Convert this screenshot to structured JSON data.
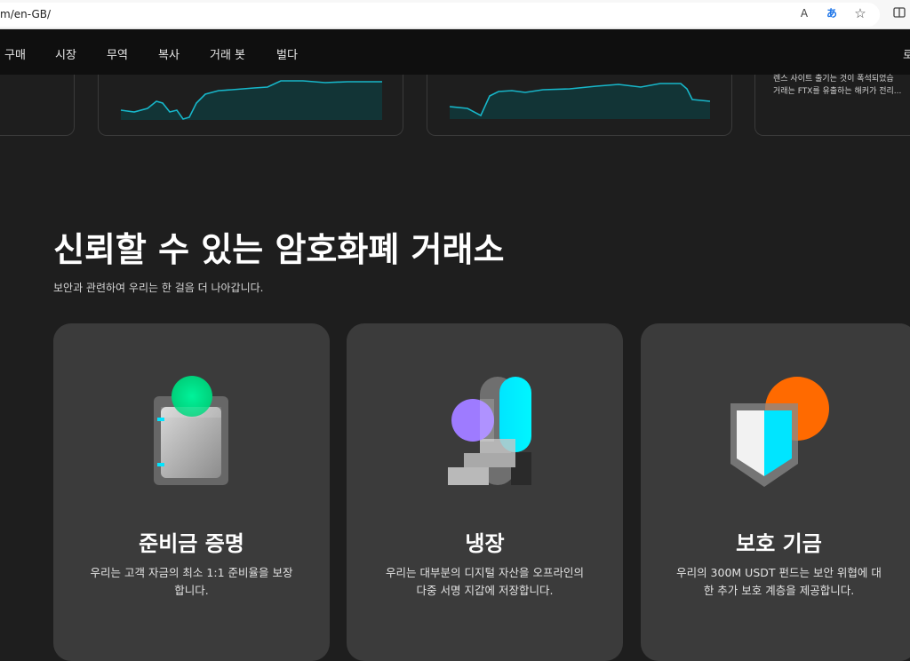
{
  "browser": {
    "url": "m/en-GB/",
    "read_aloud_icon": "A",
    "translate_icon": "あ",
    "favorite_icon": "☆",
    "reading_view_icon": "▯▯"
  },
  "nav": {
    "items": [
      "구매",
      "시장",
      "무역",
      "복사",
      "거래 봇",
      "벌다"
    ],
    "right_partial": "로"
  },
  "news_card": {
    "line1": "렌스 사이트 출기는 것이 폭석되었습",
    "line2": "거래는 FTX를 유출하는 해커가 전리..."
  },
  "hero": {
    "title": "신뢰할 수 있는 암호화폐 거래소",
    "subtitle": "보안과 관련하여 우리는 한 걸음 더 나아갑니다."
  },
  "features": [
    {
      "title": "준비금 증명",
      "desc_line1": "우리는 고객 자금의 최소 1:1 준비율을 보장",
      "desc_line2": "합니다.",
      "icon": "reserve-wallet-icon"
    },
    {
      "title": "냉장",
      "desc_line1": "우리는 대부분의 디지털 자산을 오프라인의",
      "desc_line2": "다중 서명 지갑에 저장합니다.",
      "icon": "cold-storage-icon"
    },
    {
      "title": "보호 기금",
      "desc_line1": "우리의 300M USDT 펀드는 보안 위협에 대",
      "desc_line2": "한 추가 보호 계층을 제공합니다.",
      "icon": "shield-fund-icon"
    }
  ],
  "colors": {
    "accent_cyan": "#00e5ff",
    "green": "#00e58a",
    "purple": "#9e7bff",
    "orange": "#ff6a00",
    "chart_line": "#17b6c9"
  }
}
